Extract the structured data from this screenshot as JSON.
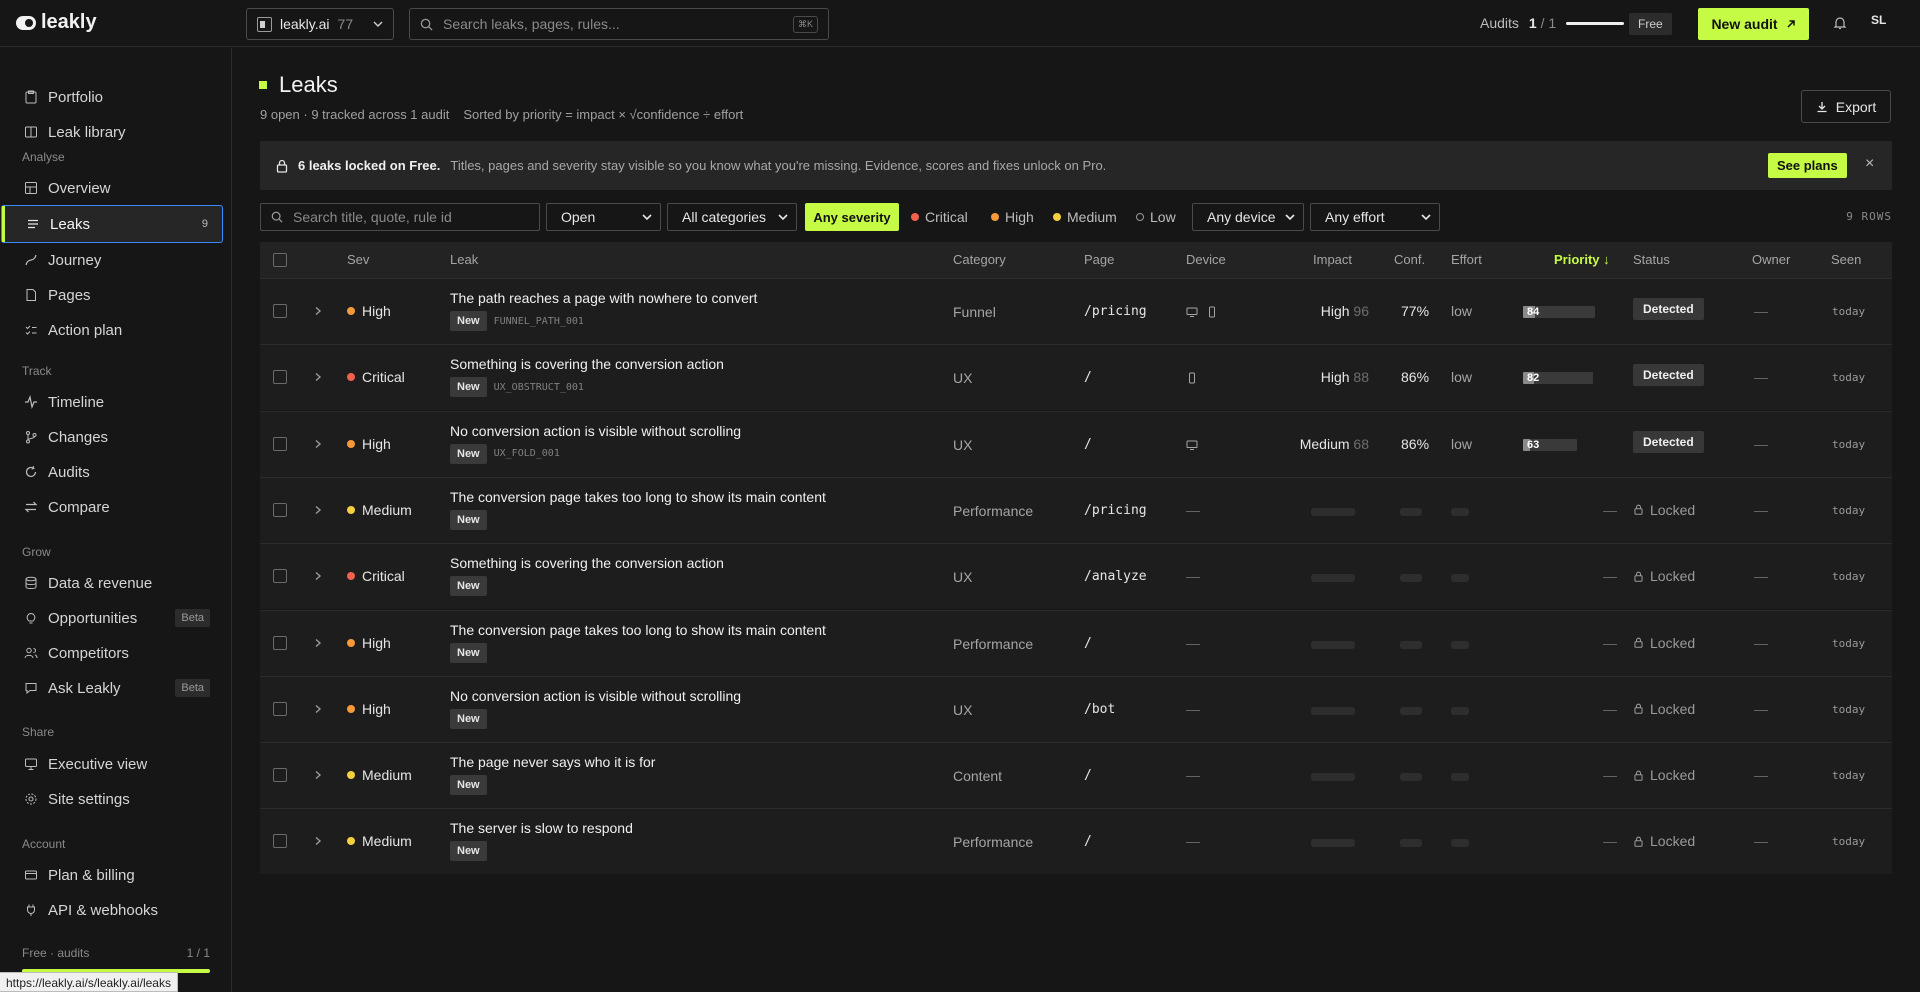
{
  "header": {
    "logo": "leakly",
    "site": {
      "name": "leakly.ai",
      "count": "77"
    },
    "search": {
      "placeholder": "Search leaks, pages, rules...",
      "shortcut": "⌘K"
    },
    "audits": {
      "label": "Audits",
      "used": "1",
      "total": "/ 1"
    },
    "plan_badge": "Free",
    "new_audit": "New audit",
    "avatar": "SL"
  },
  "sidebar": {
    "top_items": [
      {
        "label": "Portfolio",
        "icon": "clipboard-icon"
      },
      {
        "label": "Leak library",
        "icon": "book-icon"
      }
    ],
    "sections": [
      {
        "title": "Analyse",
        "items": [
          {
            "label": "Overview",
            "icon": "grid-icon"
          },
          {
            "label": "Leaks",
            "icon": "list-icon",
            "count": "9",
            "active": true
          },
          {
            "label": "Journey",
            "icon": "route-icon"
          },
          {
            "label": "Pages",
            "icon": "page-icon"
          },
          {
            "label": "Action plan",
            "icon": "checklist-icon"
          }
        ]
      },
      {
        "title": "Track",
        "items": [
          {
            "label": "Timeline",
            "icon": "activity-icon"
          },
          {
            "label": "Changes",
            "icon": "branch-icon"
          },
          {
            "label": "Audits",
            "icon": "refresh-icon"
          },
          {
            "label": "Compare",
            "icon": "swap-icon"
          }
        ]
      },
      {
        "title": "Grow",
        "items": [
          {
            "label": "Data & revenue",
            "icon": "database-icon"
          },
          {
            "label": "Opportunities",
            "icon": "bulb-icon",
            "badge": "Beta"
          },
          {
            "label": "Competitors",
            "icon": "users-icon"
          },
          {
            "label": "Ask Leakly",
            "icon": "chat-icon",
            "badge": "Beta"
          }
        ]
      },
      {
        "title": "Share",
        "items": [
          {
            "label": "Executive view",
            "icon": "presentation-icon"
          },
          {
            "label": "Site settings",
            "icon": "gear-icon"
          }
        ]
      },
      {
        "title": "Account",
        "items": [
          {
            "label": "Plan & billing",
            "icon": "card-icon"
          },
          {
            "label": "API & webhooks",
            "icon": "plug-icon"
          }
        ]
      }
    ],
    "plan": {
      "label": "Free · audits",
      "usage": "1 / 1",
      "fill": 1.0
    }
  },
  "status_url": "https://leakly.ai/s/leakly.ai/leaks",
  "main": {
    "title": "Leaks",
    "summary": "9 open · 9 tracked across 1 audit",
    "sort_note": "Sorted by priority = impact × √confidence ÷ effort",
    "export": "Export",
    "banner": {
      "bold": "6 leaks locked on Free.",
      "text": "Titles, pages and severity stay visible so you know what you're missing. Evidence, scores and fixes unlock on Pro.",
      "cta": "See plans",
      "close": "×"
    },
    "filters": {
      "search_placeholder": "Search title, quote, rule id",
      "status": "Open",
      "category": "All categories",
      "severity_any": "Any severity",
      "severity_chips": [
        {
          "label": "Critical",
          "color": "#f0624d"
        },
        {
          "label": "High",
          "color": "#f59a3b"
        },
        {
          "label": "Medium",
          "color": "#f4d03f"
        },
        {
          "label": "Low",
          "color": "#9a9a9a"
        }
      ],
      "device": "Any device",
      "effort": "Any effort",
      "rows": "9 ROWS"
    },
    "columns": {
      "sev": "Sev",
      "leak": "Leak",
      "category": "Category",
      "page": "Page",
      "device": "Device",
      "impact": "Impact",
      "conf": "Conf.",
      "effort": "Effort",
      "priority": "Priority ↓",
      "status": "Status",
      "owner": "Owner",
      "seen": "Seen"
    },
    "rows": [
      {
        "sev": "High",
        "sev_color": "#f59a3b",
        "title": "The path reaches a page with nowhere to convert",
        "tag": "New",
        "rule": "FUNNEL_PATH_001",
        "category": "Funnel",
        "page": "/pricing",
        "devices": [
          "desktop-icon",
          "mobile-icon"
        ],
        "impact_label": "High",
        "impact_score": "96",
        "conf": "77%",
        "effort": "low",
        "priority": "84",
        "status": "Detected",
        "owner": "—",
        "seen": "today",
        "locked": false
      },
      {
        "sev": "Critical",
        "sev_color": "#f0624d",
        "title": "Something is covering the conversion action",
        "tag": "New",
        "rule": "UX_OBSTRUCT_001",
        "category": "UX",
        "page": "/",
        "devices": [
          "mobile-icon"
        ],
        "impact_label": "High",
        "impact_score": "88",
        "conf": "86%",
        "effort": "low",
        "priority": "82",
        "status": "Detected",
        "owner": "—",
        "seen": "today",
        "locked": false
      },
      {
        "sev": "High",
        "sev_color": "#f59a3b",
        "title": "No conversion action is visible without scrolling",
        "tag": "New",
        "rule": "UX_FOLD_001",
        "category": "UX",
        "page": "/",
        "devices": [
          "desktop-icon"
        ],
        "impact_label": "Medium",
        "impact_score": "68",
        "conf": "86%",
        "effort": "low",
        "priority": "63",
        "status": "Detected",
        "owner": "—",
        "seen": "today",
        "locked": false
      },
      {
        "sev": "Medium",
        "sev_color": "#f4d03f",
        "title": "The conversion page takes too long to show its main content",
        "tag": "New",
        "category": "Performance",
        "page": "/pricing",
        "status": "Locked",
        "owner": "—",
        "seen": "today",
        "locked": true
      },
      {
        "sev": "Critical",
        "sev_color": "#f0624d",
        "title": "Something is covering the conversion action",
        "tag": "New",
        "category": "UX",
        "page": "/analyze",
        "status": "Locked",
        "owner": "—",
        "seen": "today",
        "locked": true
      },
      {
        "sev": "High",
        "sev_color": "#f59a3b",
        "title": "The conversion page takes too long to show its main content",
        "tag": "New",
        "category": "Performance",
        "page": "/",
        "status": "Locked",
        "owner": "—",
        "seen": "today",
        "locked": true
      },
      {
        "sev": "High",
        "sev_color": "#f59a3b",
        "title": "No conversion action is visible without scrolling",
        "tag": "New",
        "category": "UX",
        "page": "/bot",
        "status": "Locked",
        "owner": "—",
        "seen": "today",
        "locked": true
      },
      {
        "sev": "Medium",
        "sev_color": "#f4d03f",
        "title": "The page never says who it is for",
        "tag": "New",
        "category": "Content",
        "page": "/",
        "status": "Locked",
        "owner": "—",
        "seen": "today",
        "locked": true
      },
      {
        "sev": "Medium",
        "sev_color": "#f4d03f",
        "title": "The server is slow to respond",
        "tag": "New",
        "category": "Performance",
        "page": "/",
        "status": "Locked",
        "owner": "—",
        "seen": "today",
        "locked": true
      }
    ]
  },
  "colors": {
    "accent": "#c5fb45",
    "focus": "#3a8bff",
    "background": "#161616"
  }
}
